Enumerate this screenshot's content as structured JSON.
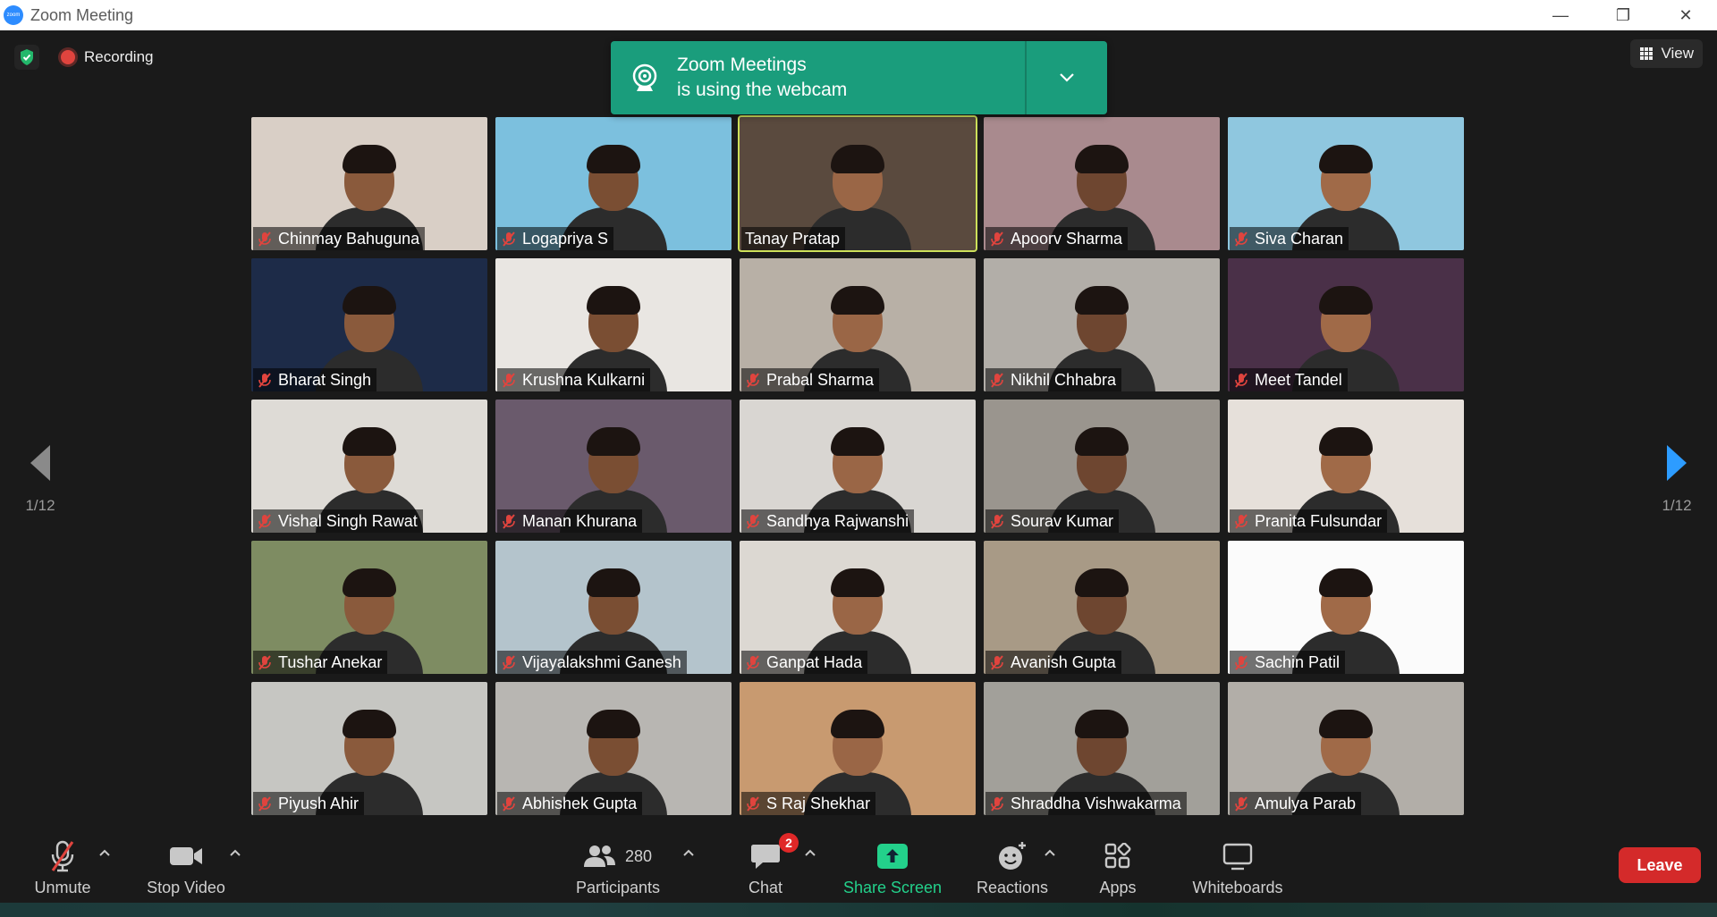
{
  "window": {
    "title": "Zoom Meeting",
    "logo_text": "zoom",
    "minimize": "—",
    "maximize": "❐",
    "close": "✕"
  },
  "top": {
    "recording_label": "Recording",
    "view_label": "View"
  },
  "webcam_notice": {
    "line1": "Zoom Meetings",
    "line2": "is using the webcam"
  },
  "pager": {
    "left_count": "1/12",
    "right_count": "1/12"
  },
  "participants": [
    {
      "name": "Chinmay Bahuguna",
      "muted": true,
      "bg": "#d9cfc6"
    },
    {
      "name": "Logapriya S",
      "muted": true,
      "bg": "#7cc0de"
    },
    {
      "name": "Tanay Pratap",
      "muted": false,
      "bg": "#5a4a3e",
      "active": true
    },
    {
      "name": "Apoorv Sharma",
      "muted": true,
      "bg": "#a98a8e"
    },
    {
      "name": "Siva Charan",
      "muted": true,
      "bg": "#8fc7df"
    },
    {
      "name": "Bharat Singh",
      "muted": true,
      "bg": "#1d2b48"
    },
    {
      "name": "Krushna Kulkarni",
      "muted": true,
      "bg": "#e9e6e2"
    },
    {
      "name": "Prabal Sharma",
      "muted": true,
      "bg": "#b8b0a6"
    },
    {
      "name": "Nikhil Chhabra",
      "muted": true,
      "bg": "#b2aea8"
    },
    {
      "name": "Meet Tandel",
      "muted": true,
      "bg": "#4a3048"
    },
    {
      "name": "Vishal Singh Rawat",
      "muted": true,
      "bg": "#dedbd6"
    },
    {
      "name": "Manan Khurana",
      "muted": true,
      "bg": "#6a5a6c"
    },
    {
      "name": "Sandhya Rajwanshi",
      "muted": true,
      "bg": "#d9d6d2"
    },
    {
      "name": "Sourav Kumar",
      "muted": true,
      "bg": "#9a958e"
    },
    {
      "name": "Pranita Fulsundar",
      "muted": true,
      "bg": "#e6e0da"
    },
    {
      "name": "Tushar Anekar",
      "muted": true,
      "bg": "#7e8c62"
    },
    {
      "name": "Vijayalakshmi Ganesh",
      "muted": true,
      "bg": "#b4c4cc"
    },
    {
      "name": "Ganpat Hada",
      "muted": true,
      "bg": "#dcd8d2"
    },
    {
      "name": "Avanish Gupta",
      "muted": true,
      "bg": "#a89a86"
    },
    {
      "name": "Sachin Patil",
      "muted": true,
      "bg": "#fbfbfb"
    },
    {
      "name": "Piyush Ahir",
      "muted": true,
      "bg": "#c6c6c2"
    },
    {
      "name": "Abhishek Gupta",
      "muted": true,
      "bg": "#b8b6b2"
    },
    {
      "name": "S Raj Shekhar",
      "muted": true,
      "bg": "#c89a70"
    },
    {
      "name": "Shraddha Vishwakarma",
      "muted": true,
      "bg": "#a2a09a"
    },
    {
      "name": "Amulya Parab",
      "muted": true,
      "bg": "#b2aea8"
    }
  ],
  "toolbar": {
    "unmute_label": "Unmute",
    "stop_video_label": "Stop Video",
    "participants_label": "Participants",
    "participants_count": "280",
    "chat_label": "Chat",
    "chat_badge": "2",
    "share_screen_label": "Share Screen",
    "reactions_label": "Reactions",
    "apps_label": "Apps",
    "whiteboards_label": "Whiteboards",
    "leave_label": "Leave"
  },
  "colors": {
    "accent_green": "#1a9d7c",
    "active_speaker": "#cde05a",
    "leave_red": "#d42a2a",
    "share_green": "#23d18b"
  }
}
